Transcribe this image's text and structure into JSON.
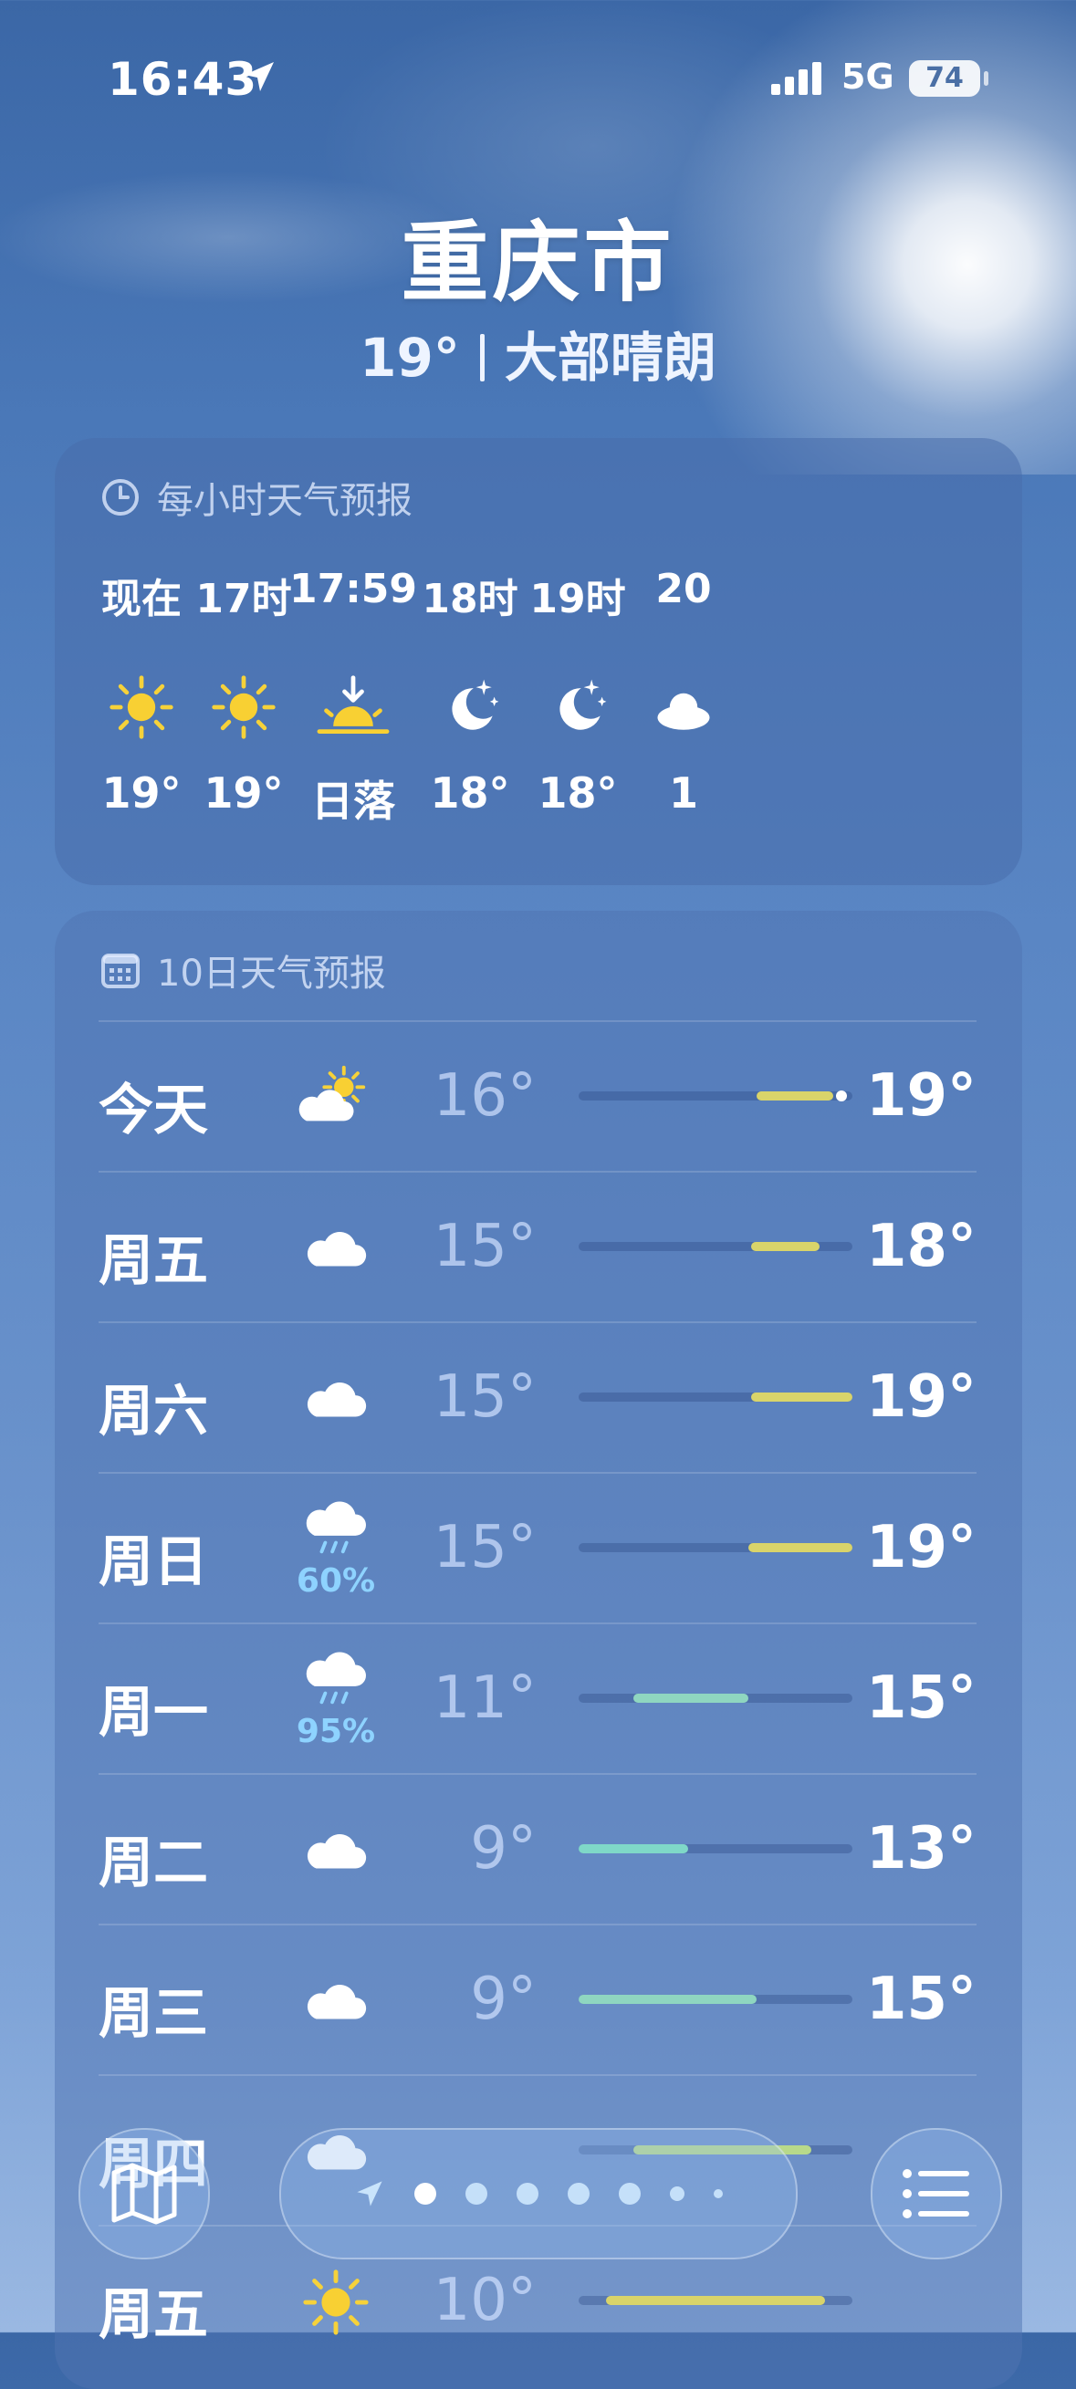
{
  "status": {
    "time": "16:43",
    "network": "5G",
    "battery": "74"
  },
  "location": {
    "city": "重庆市",
    "temp": "19°",
    "condition": "大部晴朗"
  },
  "hourly": {
    "title": "每小时天气预报",
    "items": [
      {
        "label": "现在",
        "icon": "sun-icon",
        "temp": "19°"
      },
      {
        "label": "17时",
        "icon": "sun-icon",
        "temp": "19°"
      },
      {
        "label": "17:59",
        "icon": "sunset-icon",
        "temp": "日落"
      },
      {
        "label": "18时",
        "icon": "moon-stars-icon",
        "temp": "18°"
      },
      {
        "label": "19时",
        "icon": "moon-stars-icon",
        "temp": "18°"
      },
      {
        "label": "20",
        "icon": "moon-cloud-icon",
        "temp": "1"
      }
    ]
  },
  "daily": {
    "title": "10日天气预报",
    "items": [
      {
        "day": "今天",
        "icon": "partly-cloudy-icon",
        "precip": "",
        "lo": "16°",
        "hi": "19°",
        "range": [
          0.65,
          0.93
        ],
        "color": "#d9d46a",
        "current": 0.96
      },
      {
        "day": "周五",
        "icon": "cloud-icon",
        "precip": "",
        "lo": "15°",
        "hi": "18°",
        "range": [
          0.63,
          0.88
        ],
        "color": "#d9d46a"
      },
      {
        "day": "周六",
        "icon": "cloud-icon",
        "precip": "",
        "lo": "15°",
        "hi": "19°",
        "range": [
          0.63,
          1.0
        ],
        "color": "#d9d46a"
      },
      {
        "day": "周日",
        "icon": "rain-icon",
        "precip": "60%",
        "lo": "15°",
        "hi": "19°",
        "range": [
          0.62,
          1.0
        ],
        "color": "#d9d46a"
      },
      {
        "day": "周一",
        "icon": "rain-icon",
        "precip": "95%",
        "lo": "11°",
        "hi": "15°",
        "range": [
          0.2,
          0.62
        ],
        "color": "#8fd6c0"
      },
      {
        "day": "周二",
        "icon": "cloud-icon",
        "precip": "",
        "lo": "9°",
        "hi": "13°",
        "range": [
          0.0,
          0.4
        ],
        "color": "#7fd8c8"
      },
      {
        "day": "周三",
        "icon": "cloud-icon",
        "precip": "",
        "lo": "9°",
        "hi": "15°",
        "range": [
          0.0,
          0.65
        ],
        "color": "#8fd6c0"
      },
      {
        "day": "周四",
        "icon": "cloud-icon",
        "precip": "",
        "lo": "",
        "hi": "",
        "range": [
          0.2,
          0.85
        ],
        "color": "#b8d98a"
      },
      {
        "day": "周五",
        "icon": "sun-icon",
        "precip": "",
        "lo": "10°",
        "hi": "",
        "range": [
          0.1,
          0.9
        ],
        "color": "#d9d46a"
      }
    ]
  },
  "toolbar": {
    "map": "map-icon",
    "list": "list-icon",
    "pages": 6
  }
}
